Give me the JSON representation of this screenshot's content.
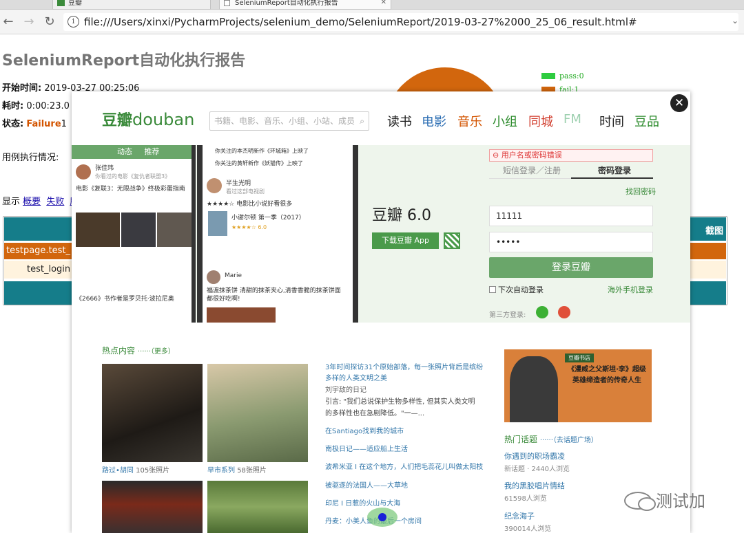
{
  "browser": {
    "tabs": [
      {
        "label": "豆瓣"
      },
      {
        "label": "SeleniumReport自动化执行报告"
      }
    ],
    "url": "file:///Users/xinxi/PycharmProjects/selenium_demo/SeleniumReport/2019-03-27%2000_25_06_result.html#"
  },
  "report": {
    "title": "SeleniumReport自动化执行报告",
    "start_label": "开始时间:",
    "start_value": "2019-03-27 00:25:06",
    "duration_label": "耗时:",
    "duration_value": "0:00:23.0",
    "status_label": "状态:",
    "status_value": "Failure",
    "status_count": "1",
    "usage_label": "用例执行情况:",
    "show_prefix": "显示",
    "filters": [
      "概要",
      "失败",
      "所"
    ],
    "legend": [
      {
        "label": "pass:0",
        "color": "#2ecc40"
      },
      {
        "label": "fail:1",
        "color": "#d2660d"
      }
    ],
    "table": {
      "screenshot_header": "截图",
      "suite": "testpage.test_",
      "case": "test_login"
    }
  },
  "douban": {
    "logo_cn": "豆瓣",
    "logo_en": "douban",
    "search_placeholder": "书籍、电影、音乐、小组、小站、成员",
    "nav": [
      {
        "label": "读书",
        "color": "#222222"
      },
      {
        "label": "电影",
        "color": "#2e6fb4"
      },
      {
        "label": "音乐",
        "color": "#d35400"
      },
      {
        "label": "小组",
        "color": "#2a8a2a"
      },
      {
        "label": "同城",
        "color": "#d03a2a"
      },
      {
        "label": "FM",
        "color": "#9ed0b0"
      },
      {
        "label": "时间",
        "color": "#222222"
      },
      {
        "label": "豆品",
        "color": "#2a8a2a"
      }
    ],
    "app": {
      "tabs": [
        "动态",
        "推荐"
      ],
      "user1": "张佳玮",
      "user1_sub": "你看过的电影《复仇者联盟3》",
      "post1": "电影《复联3：无限战争》终极彩蛋指南",
      "user2": "半生光明",
      "user2_sub": "看过这部电视剧",
      "post2": "★★★★☆  电影比小说好看很多",
      "drama": "小谢尔顿 第一季（2017）",
      "drama_rating": "★★★★☆ 6.0",
      "user3": "Marie",
      "post3": "福渡抹茶饼 清甜的抹茶夹心,清香香脆的抹茶饼面都很好吃啊!",
      "book_post": "《2666》书作者是罗贝托·波拉尼奥",
      "notice1": "你关注的本杰明新作《环城箱》上映了",
      "notice2": "你关注的黄轩新作《妖猫传》上映了"
    },
    "app_name": "豆瓣 6.0",
    "download_label": "下载豆瓣 App",
    "login": {
      "error": "用户名或密码错误",
      "tab_sms": "短信登录／注册",
      "tab_password": "密码登录",
      "find_password": "找回密码",
      "username": "11111",
      "password": "•••••",
      "submit": "登录豆瓣",
      "auto_login": "下次自动登录",
      "overseas": "海外手机登录",
      "third_party": "第三方登录:"
    },
    "hot": {
      "title": "热点内容",
      "more": "······（更多）",
      "albums": [
        {
          "title": "路过•胡同",
          "count": "105张照片"
        },
        {
          "title": "早市系列",
          "count": "58张照片"
        }
      ],
      "articles": [
        {
          "title": "3年时间探访31个原始部落，每一张照片背后是缤纷",
          "title2": "多样的人类文明之美",
          "author": "刘宇敌的日记",
          "body1": "引言: \"我们总说保护生物多样性, 但其实人类文明",
          "body2": "的多样性也在急剧降低。\"一—..."
        },
        {
          "title": "在Santiago找到我的城市"
        },
        {
          "title": "南极日记——适应船上生活"
        },
        {
          "title": "波希米亚 I 在这个地方，人们把毛蕊花儿叫做太阳枝"
        },
        {
          "title": "被驱逐的法国人——大草地"
        },
        {
          "title": "印尼 I 日惹的火山与大海"
        },
        {
          "title": "丹麦：小美人鱼的最后一个房间"
        }
      ]
    },
    "poster": {
      "badge": "豆瓣书店",
      "title": "《漫威之父斯坦·李》超级英雄缔造者的传奇人生"
    },
    "topics": {
      "title": "热门话题",
      "plaza": "······（去话题广场）",
      "items": [
        {
          "name": "你遇到的职场霸凌",
          "stat": "新话题 · 2440人浏览"
        },
        {
          "name": "我的黑胶唱片情结",
          "stat": "61598人浏览"
        },
        {
          "name": "纪念海子",
          "stat": "390014人浏览"
        }
      ]
    }
  },
  "watermark": "测试加"
}
